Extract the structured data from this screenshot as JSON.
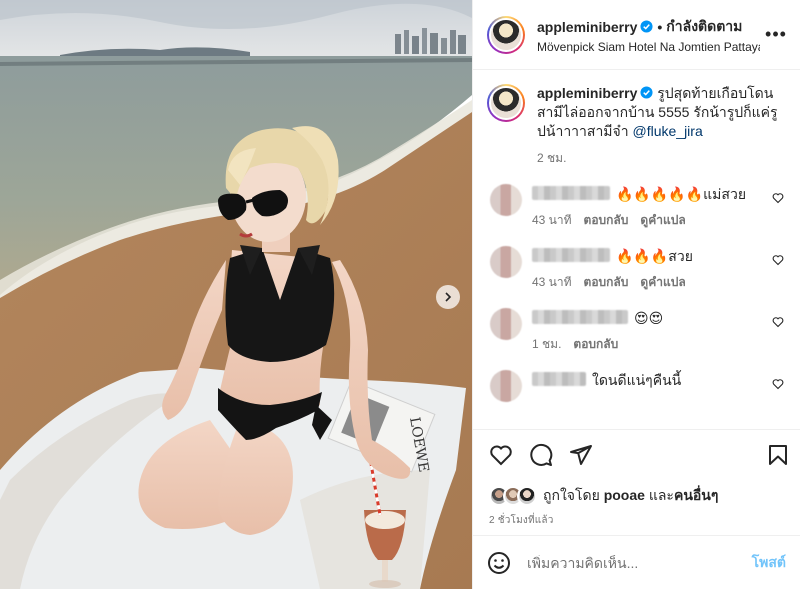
{
  "post": {
    "username": "appleminiberry",
    "separator": "•",
    "follow_status": "กำลังติดตาม",
    "location": "Mövenpick Siam Hotel Na Jomtien Pattaya",
    "more_label": "•••"
  },
  "caption": {
    "username": "appleminiberry",
    "text": " รูปสุดท้ายเกือบโดนสามีไล่ออกจากบ้าน 5555 รักน้ารูปก็แค่รูปน้าาาาสามีจ๋า ",
    "mention": "@fluke_jira",
    "time": "2 ชม."
  },
  "comments": [
    {
      "text": "🔥🔥🔥🔥🔥แม่สวย",
      "time": "43 นาที",
      "reply": "ตอบกลับ",
      "translate": "ดูคำแปล"
    },
    {
      "text": "🔥🔥🔥สวย",
      "time": "43 นาที",
      "reply": "ตอบกลับ",
      "translate": "ดูคำแปล"
    },
    {
      "text": "😍😍",
      "time": "1 ชม.",
      "reply": "ตอบกลับ",
      "translate": ""
    },
    {
      "text": "ใดนดีแน่ๆคืนนี้",
      "time": "",
      "reply": "",
      "translate": ""
    }
  ],
  "likes": {
    "prefix": "ถูกใจโดย ",
    "user": "pooae",
    "and": " และ",
    "others": "คนอื่นๆ"
  },
  "timestamp": "2 ชั่วโมงที่แล้ว",
  "add_comment": {
    "placeholder": "เพิ่มความคิดเห็น...",
    "post_label": "โพสต์"
  },
  "photo": {
    "towel_text": "LOEWE"
  },
  "colors": {
    "verified": "#0095f6",
    "link": "#00376b",
    "secondary_text": "#737373",
    "post_button": "#0095f6"
  }
}
